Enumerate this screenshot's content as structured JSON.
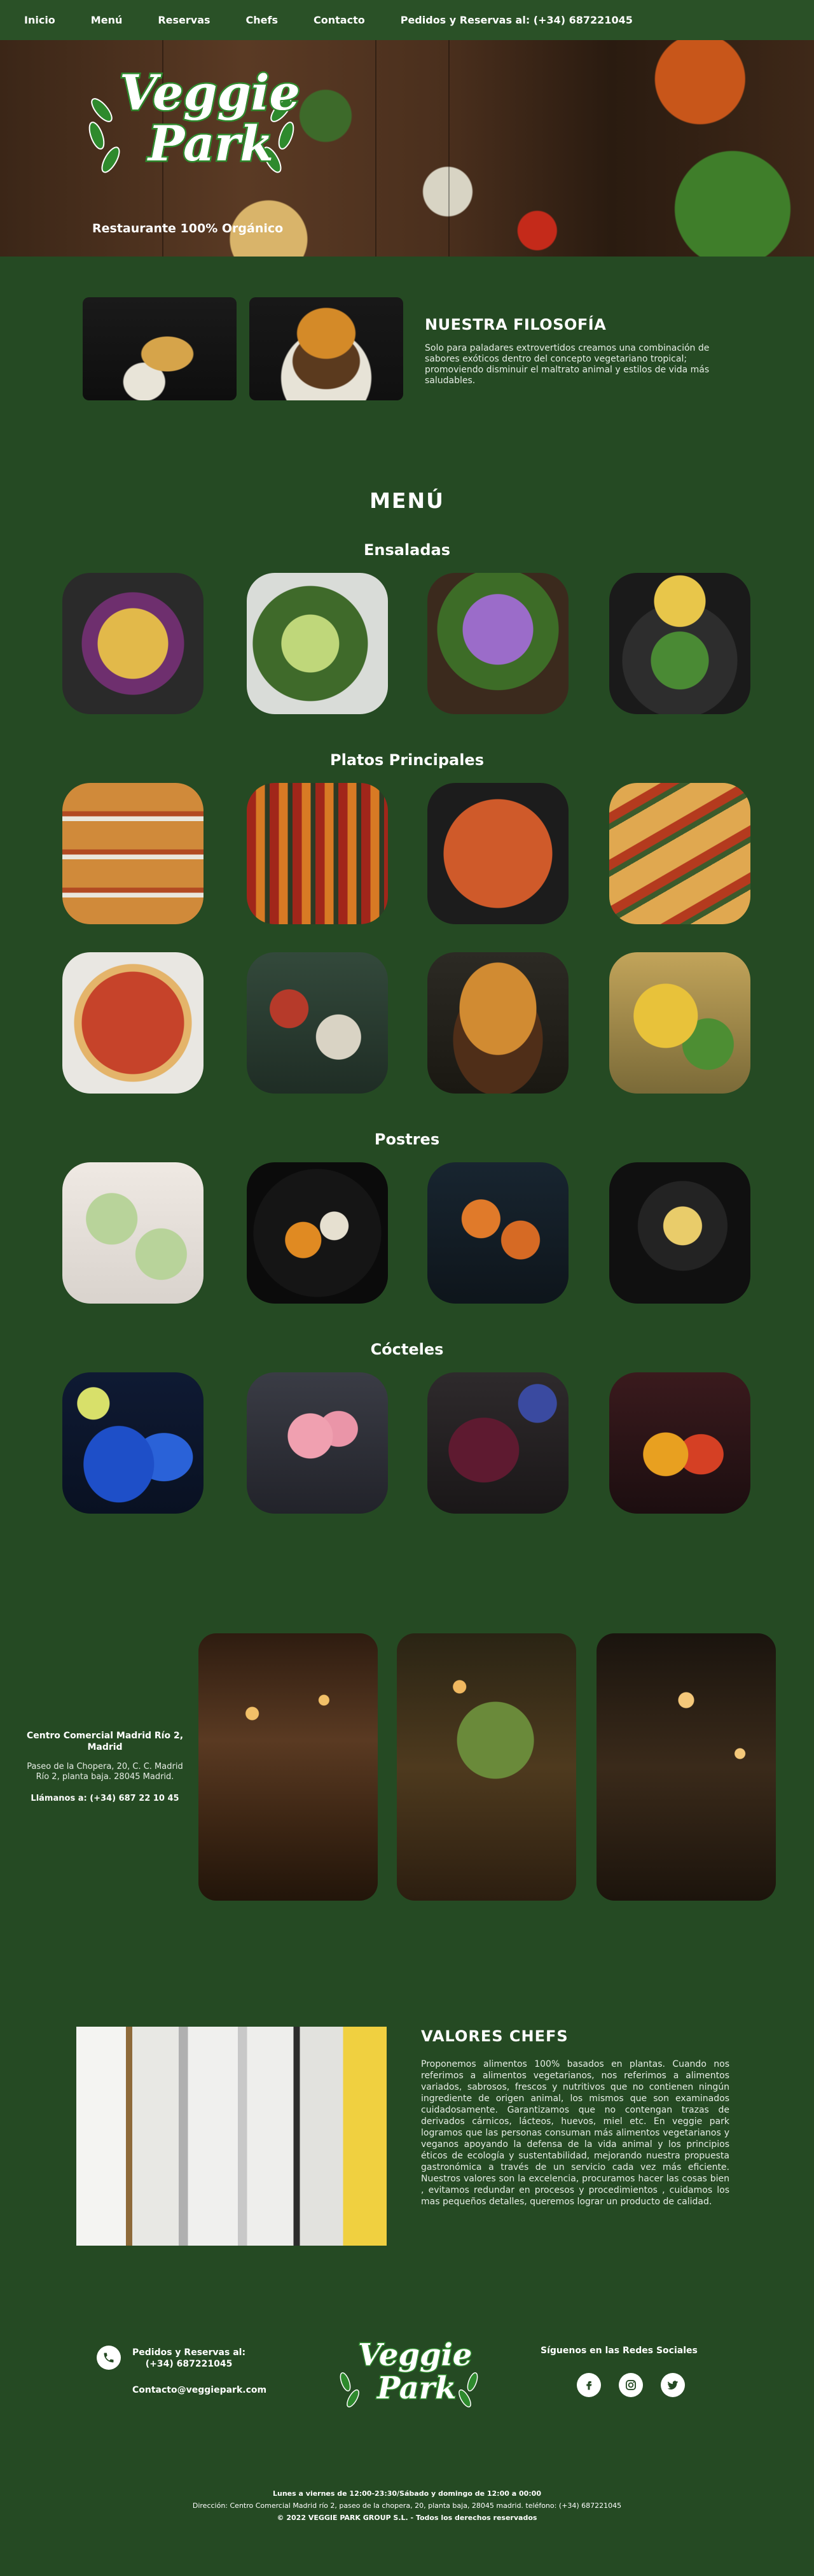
{
  "nav": {
    "items": [
      "Inicio",
      "Menú",
      "Reservas",
      "Chefs",
      "Contacto",
      "Pedidos y Reservas al: (+34) 687221045"
    ]
  },
  "hero": {
    "logo_line1": "Veggie",
    "logo_line2": "Park",
    "tagline": "Restaurante 100% Orgánico"
  },
  "philosophy": {
    "title": "NUESTRA FILOSOFÍA",
    "text": "Solo para paladares extrovertidos creamos una combinación de sabores exóticos dentro del concepto vegetariano tropical; promoviendo disminuir el maltrato animal y estilos de vida más saludables."
  },
  "menu": {
    "title": "MENÚ",
    "sections": [
      {
        "title": "Ensaladas"
      },
      {
        "title": "Platos Principales"
      },
      {
        "title": "Postres"
      },
      {
        "title": "Cócteles"
      }
    ]
  },
  "location": {
    "name": "Centro Comercial Madrid Río 2, Madrid",
    "address": "Paseo de la Chopera, 20, C. C. Madrid Río 2, planta baja. 28045 Madrid.",
    "phone": "Llámanos a: (+34) 687 22 10 45"
  },
  "chefs": {
    "title": "VALORES CHEFS",
    "text": "Proponemos alimentos 100% basados en plantas. Cuando nos referimos a alimentos vegetarianos, nos referimos a alimentos variados, sabrosos, frescos y nutritivos que no contienen ningún ingrediente de origen animal, los mismos que son examinados cuidadosamente. Garantizamos que no contengan trazas de derivados cárnicos, lácteos, huevos, miel etc. En veggie park logramos que las personas consuman más alimentos vegetarianos y veganos apoyando la defensa de la vida animal y los principios éticos de ecología y sustentabilidad, mejorando nuestra propuesta gastronómica a través de un servicio cada vez más eficiente. Nuestros valores son la excelencia, procuramos hacer las cosas bien , evitamos redundar en procesos y procedimientos , cuidamos los mas pequeños detalles, queremos lograr un producto de calidad."
  },
  "footer": {
    "phone_label": "Pedidos y Reservas al:",
    "phone": "(+34) 687221045",
    "email": "Contacto@veggiepark.com",
    "logo_line1": "Veggie",
    "logo_line2": "Park",
    "social_title": "Síguenos en las Redes Sociales",
    "hours": "Lunes a viernes de 12:00-23:30/Sábado y domingo de 12:00 a 00:00",
    "address": "Dirección: Centro Comercial Madrid río 2, paseo de la chopera, 20, planta baja, 28045 madrid. teléfono: (+34) 687221045",
    "copyright": "© 2022 VEGGIE PARK GROUP S.L. - Todos los derechos reservados"
  },
  "colors": {
    "background": "#254a23",
    "nav": "#2a5127",
    "logo_green": "#2e8a2d"
  },
  "icons": [
    "phone-icon",
    "facebook-icon",
    "instagram-icon",
    "twitter-icon"
  ]
}
